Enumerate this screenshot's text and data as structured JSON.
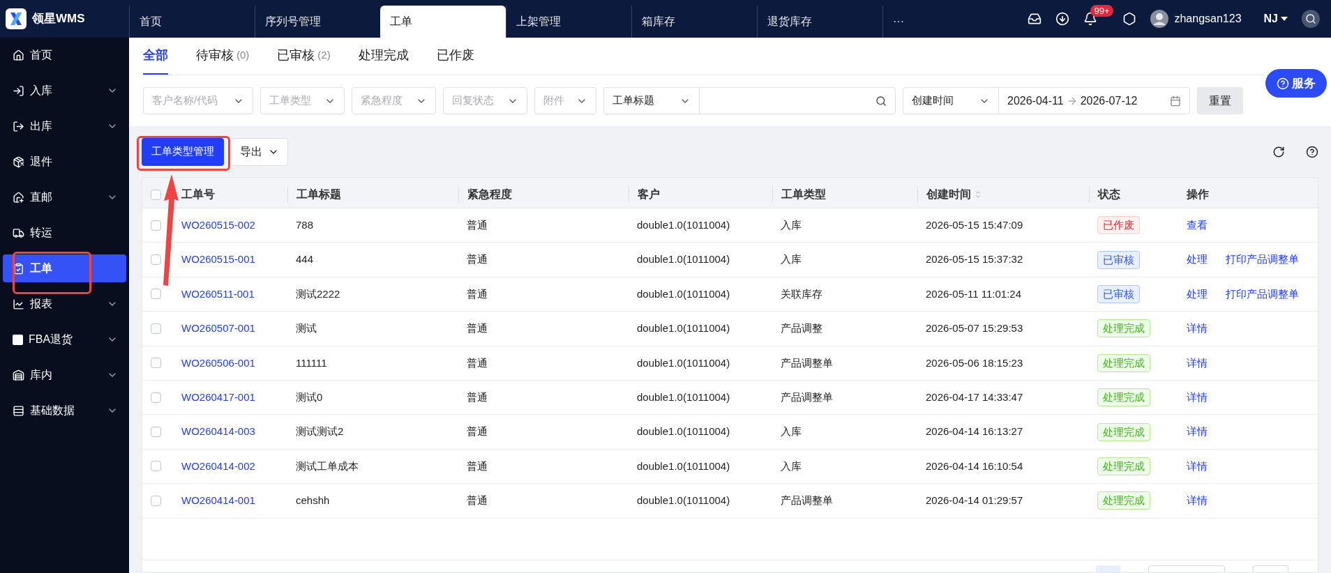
{
  "app": {
    "name": "领星WMS"
  },
  "top_tabs": [
    {
      "label": "首页",
      "selected": false
    },
    {
      "label": "序列号管理",
      "selected": false
    },
    {
      "label": "工单",
      "selected": true
    },
    {
      "label": "上架管理",
      "selected": false
    },
    {
      "label": "箱库存",
      "selected": false
    },
    {
      "label": "退货库存",
      "selected": false
    },
    {
      "label": "···",
      "selected": false
    }
  ],
  "header": {
    "notification_badge": "99+",
    "username": "zhangsan123",
    "warehouse": "NJ"
  },
  "sidebar": {
    "items": [
      {
        "label": "首页",
        "expandable": false,
        "selected": false
      },
      {
        "label": "入库",
        "expandable": true,
        "selected": false
      },
      {
        "label": "出库",
        "expandable": true,
        "selected": false
      },
      {
        "label": "退件",
        "expandable": false,
        "selected": false
      },
      {
        "label": "直邮",
        "expandable": true,
        "selected": false
      },
      {
        "label": "转运",
        "expandable": false,
        "selected": false
      },
      {
        "label": "工单",
        "expandable": false,
        "selected": true
      },
      {
        "label": "报表",
        "expandable": true,
        "selected": false
      },
      {
        "label": "FBA退货",
        "expandable": true,
        "selected": false
      },
      {
        "label": "库内",
        "expandable": true,
        "selected": false
      },
      {
        "label": "基础数据",
        "expandable": true,
        "selected": false
      }
    ]
  },
  "status_tabs": [
    {
      "label": "全部",
      "selected": true
    },
    {
      "label": "待审核",
      "count": "(0)",
      "selected": false
    },
    {
      "label": "已审核",
      "count": "(2)",
      "selected": false
    },
    {
      "label": "处理完成",
      "selected": false
    },
    {
      "label": "已作废",
      "selected": false
    }
  ],
  "filters": {
    "selects": [
      {
        "placeholder": "客户名称/代码"
      },
      {
        "placeholder": "工单类型"
      },
      {
        "placeholder": "紧急程度"
      },
      {
        "placeholder": "回复状态"
      },
      {
        "placeholder": "附件"
      }
    ],
    "search_field": {
      "value": "工单标题"
    },
    "date_field": {
      "value": "创建时间"
    },
    "date_range": {
      "start": "2026-04-11",
      "end": "2026-07-12"
    },
    "reset_button": "重置"
  },
  "service_button": "服务",
  "toolbar": {
    "primary_button": {
      "label": "工单类型管理"
    },
    "export_button": "导出"
  },
  "annotations": [
    {
      "kind": "frame"
    },
    {
      "kind": "arrow"
    },
    {
      "kind": "frame"
    }
  ],
  "table": {
    "all_checked": false,
    "columns": [
      "工单号",
      "工单标题",
      "紧急程度",
      "客户",
      "工单类型",
      "创建时间",
      "状态",
      "操作"
    ],
    "rows": [
      {
        "checked": false,
        "no": "WO260515-002",
        "title": "788",
        "urgency": "普通",
        "customer": "double1.0(1011004)",
        "type": "入库",
        "created": "2026-05-15 15:47:09",
        "status": {
          "text": "已作废",
          "kind": "voided"
        },
        "actions": [
          "查看"
        ]
      },
      {
        "checked": false,
        "no": "WO260515-001",
        "title": "444",
        "urgency": "普通",
        "customer": "double1.0(1011004)",
        "type": "入库",
        "created": "2026-05-15 15:37:32",
        "status": {
          "text": "已审核",
          "kind": "approved"
        },
        "actions": [
          "处理",
          "打印产品调整单"
        ]
      },
      {
        "checked": false,
        "no": "WO260511-001",
        "title": "测试2222",
        "urgency": "普通",
        "customer": "double1.0(1011004)",
        "type": "关联库存",
        "created": "2026-05-11 11:01:24",
        "status": {
          "text": "已审核",
          "kind": "approved"
        },
        "actions": [
          "处理",
          "打印产品调整单"
        ]
      },
      {
        "checked": false,
        "no": "WO260507-001",
        "title": "测试",
        "urgency": "普通",
        "customer": "double1.0(1011004)",
        "type": "产品调整",
        "created": "2026-05-07 15:29:53",
        "status": {
          "text": "处理完成",
          "kind": "done"
        },
        "actions": [
          "详情"
        ]
      },
      {
        "checked": false,
        "no": "WO260506-001",
        "title": "111111",
        "urgency": "普通",
        "customer": "double1.0(1011004)",
        "type": "产品调整单",
        "created": "2026-05-06 18:15:23",
        "status": {
          "text": "处理完成",
          "kind": "done"
        },
        "actions": [
          "详情"
        ]
      },
      {
        "checked": false,
        "no": "WO260417-001",
        "title": "测试0",
        "urgency": "普通",
        "customer": "double1.0(1011004)",
        "type": "产品调整单",
        "created": "2026-04-17 14:33:47",
        "status": {
          "text": "处理完成",
          "kind": "done"
        },
        "actions": [
          "详情"
        ]
      },
      {
        "checked": false,
        "no": "WO260414-003",
        "title": "测试测试2",
        "urgency": "普通",
        "customer": "double1.0(1011004)",
        "type": "入库",
        "created": "2026-04-14 16:13:27",
        "status": {
          "text": "处理完成",
          "kind": "done"
        },
        "actions": [
          "详情"
        ]
      },
      {
        "checked": false,
        "no": "WO260414-002",
        "title": "测试工单成本",
        "urgency": "普通",
        "customer": "double1.0(1011004)",
        "type": "入库",
        "created": "2026-04-14 16:10:54",
        "status": {
          "text": "处理完成",
          "kind": "done"
        },
        "actions": [
          "详情"
        ]
      },
      {
        "checked": false,
        "no": "WO260414-001",
        "title": "cehshh",
        "urgency": "普通",
        "customer": "double1.0(1011004)",
        "type": "产品调整单",
        "created": "2026-04-14 01:29:57",
        "status": {
          "text": "处理完成",
          "kind": "done"
        },
        "actions": [
          "详情"
        ]
      }
    ]
  }
}
